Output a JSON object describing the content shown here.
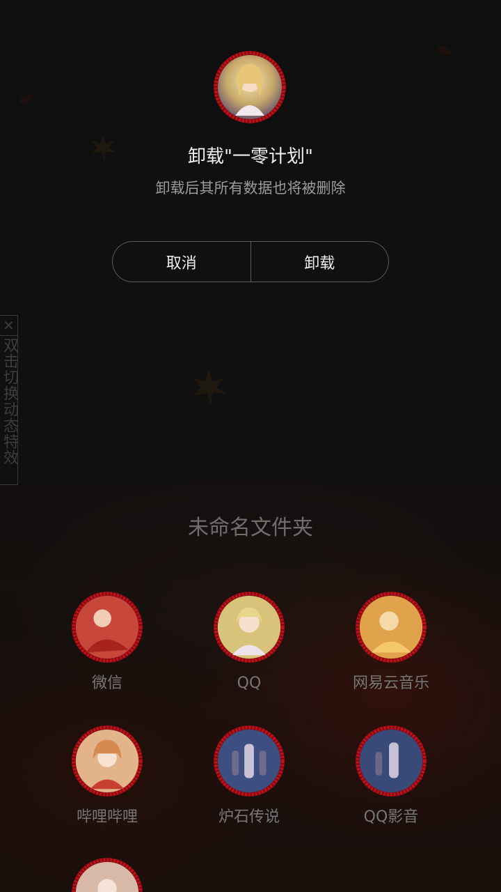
{
  "dialog": {
    "title": "卸载\"一零计划\"",
    "message": "卸载后其所有数据也将被删除",
    "cancel_label": "取消",
    "uninstall_label": "卸载",
    "app_icon": "anime-avatar-icon"
  },
  "side_hint": {
    "close_glyph": "✕",
    "text": "双击切换动态特效"
  },
  "folder": {
    "name": "未命名文件夹",
    "apps": [
      {
        "label": "微信",
        "icon": "anime-avatar-icon",
        "tint": "#c7473a"
      },
      {
        "label": "QQ",
        "icon": "anime-avatar-icon",
        "tint": "#d9c27a"
      },
      {
        "label": "网易云音乐",
        "icon": "anime-avatar-icon",
        "tint": "#e0a24a"
      },
      {
        "label": "哔哩哔哩",
        "icon": "anime-avatar-icon",
        "tint": "#e3b48a"
      },
      {
        "label": "炉石传说",
        "icon": "anime-avatar-icon",
        "tint": "#3d4f80"
      },
      {
        "label": "QQ影音",
        "icon": "anime-avatar-icon",
        "tint": "#3a4a78"
      },
      {
        "label": "",
        "icon": "anime-avatar-icon",
        "tint": "#d8b9a8"
      }
    ]
  },
  "colors": {
    "ring": "#c0101a",
    "text_primary": "#f0f0f0",
    "text_secondary": "#9c9c9c"
  }
}
